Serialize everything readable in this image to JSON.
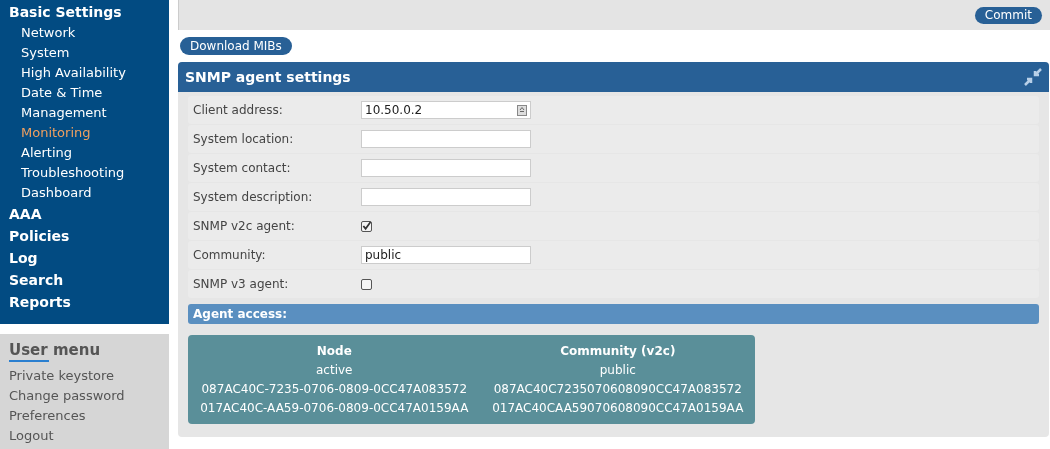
{
  "sidebar": {
    "sections": [
      {
        "label": "Basic Settings",
        "children": [
          {
            "label": "Network",
            "selected": false
          },
          {
            "label": "System",
            "selected": false
          },
          {
            "label": "High Availability",
            "selected": false
          },
          {
            "label": "Date & Time",
            "selected": false
          },
          {
            "label": "Management",
            "selected": false
          },
          {
            "label": "Monitoring",
            "selected": true
          },
          {
            "label": "Alerting",
            "selected": false
          },
          {
            "label": "Troubleshooting",
            "selected": false
          },
          {
            "label": "Dashboard",
            "selected": false
          }
        ]
      },
      {
        "label": "AAA"
      },
      {
        "label": "Policies"
      },
      {
        "label": "Log"
      },
      {
        "label": "Search"
      },
      {
        "label": "Reports"
      }
    ]
  },
  "user_menu": {
    "title": "User menu",
    "items": [
      "Private keystore",
      "Change password",
      "Preferences",
      "Logout"
    ]
  },
  "top_bar": {
    "commit_button": "Commit"
  },
  "download_button": "Download MIBs",
  "panel": {
    "title": "SNMP agent settings",
    "fields": [
      {
        "kind": "text",
        "label": "Client address:",
        "value": "10.50.0.2",
        "has_picker": true
      },
      {
        "kind": "text",
        "label": "System location:"
      },
      {
        "kind": "text",
        "label": "System contact:"
      },
      {
        "kind": "text",
        "label": "System description:"
      },
      {
        "kind": "checkbox",
        "label": "SNMP v2c agent:",
        "checked": true
      },
      {
        "kind": "text",
        "label": "Community:",
        "value": "public"
      },
      {
        "kind": "checkbox",
        "label": "SNMP v3 agent:",
        "checked": false
      }
    ],
    "section_title": "Agent access:",
    "table": {
      "columns": [
        "Node",
        "Community (v2c)"
      ],
      "rows": [
        [
          "active",
          "public"
        ],
        [
          "087AC40C-7235-0706-0809-0CC47A083572",
          "087AC40C7235070608090CC47A083572"
        ],
        [
          "017AC40C-AA59-0706-0809-0CC47A0159AA",
          "017AC40CAA59070608090CC47A0159AA"
        ]
      ]
    }
  }
}
